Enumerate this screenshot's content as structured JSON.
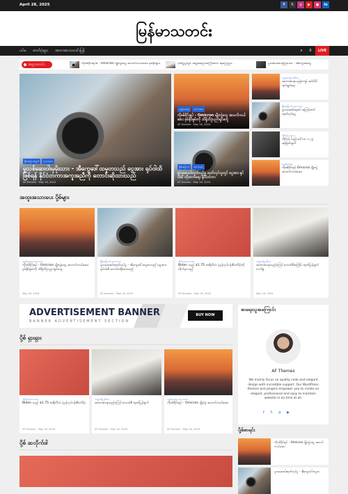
{
  "topbar": {
    "date": "April 28, 2025",
    "social": [
      "f",
      "𝕏",
      "◎",
      "▶",
      "●",
      "in"
    ]
  },
  "brand": {
    "logo": "မြန်မာသတင်း"
  },
  "nav": {
    "items": [
      "ပင်မ",
      "ဓာတ်ပုံများ",
      "အားကစားသတင်းပြန်"
    ],
    "live_label": "LIVE",
    "count": "0"
  },
  "ticker": {
    "label": "အထူးသတင်း",
    "items": [
      "ကိုဗစ်ဗိုင်းရပ်စ် - Omicron မျိုးကွဲတွေ အသက်ကယ်ဆေး ခုခံနိုင်စွမ်း",
      "ဂုဏ်ပြုပွဲတွင် အဖွဲ့အစည်းအကြီးအကဲ ဆုကြေညာ",
      "မှုသစ်မထားခဲ့ကြသော - အီကွေအတွေ"
    ]
  },
  "hero": {
    "main": {
      "cats": [
        "ခြိမ်းခြောက်ချက်",
        "အားကစား"
      ],
      "title": "မှုသစ်ဆေးဝါးမှမိုးသား - အီကွေဒေါ်ထမှုတသည် ငွေအား ရုပ်ဝါထိ ဖြစ်ရန် နိုင်ငံတကာအကူအညီကို တောင်းဆိုထားသည်",
      "author": "AF themes",
      "date": "May 16, 2024"
    },
    "mid1": {
      "cats": [
        "ကျန်းမာရေး",
        "အားကစား"
      ],
      "title": "ကိုဗစ်ဗိုင်းရပ် - Omicron မျိုးကွဲတွေ အသက်ကယ်ဆေး ခုခံနိုင်စွမ်းကို သိရှိသိပ္ပံပညာရှင်တွေ",
      "author": "AF themes",
      "date": "May 16, 2024"
    },
    "mid2": {
      "cats": [
        "ခြိမ်းခြောက်",
        "အားကစား"
      ],
      "title": "မူလဆေးဝါးထုတ်လုပ်မှု ထုတ်လုပ်သူတွင် ငွေအား ရုပ်ဝါထိ တိုးတက်ရေး နိုင်ငံတကာ",
      "author": "AF themes",
      "date": "May 16, 2024"
    }
  },
  "side_list": [
    {
      "cat": "ကျန်းမာရေး ခိုင်မာ",
      "title": "အားကစားနာမည်ကျော် အင်္ဂလိပ် အုပ်ချုပ်ရေး"
    },
    {
      "cat": "ခြိမ်းခြောက် အားကစား",
      "title": "မူလဆေးဝါးထုတ် အကြမ်းဖက် ထုတ်လုပ်ငွေ"
    },
    {
      "cat": "ဘိုင်ဒန် ဘူ့လာ",
      "title": "ဘိုင်ဒန် သည် ဒေါ်လာ ၁.၇၅ ဆုံးဖြတ်ချက်"
    },
    {
      "cat": "ကျန်းမာရေး",
      "title": "ကိုဗစ်ဗိုင်းရပ် Omicron မျိုးကွဲ အသက်ကယ်ဆေး"
    }
  ],
  "sec_popular": {
    "title": "အထူးအသားပေး ပို့စ်များ",
    "items": [
      {
        "cat": "ကျန်းမာရေး အားကစား",
        "title": "ကိုဗစ်ဗိုင်းရပ် - Omicron မျိုးကွဲတွေ အသက်ကယ်ဆေး ခုခံနိုင်စွမ်းကို သိရှိသိပ္ပံပညာရှင်တွေ",
        "date": "May 16, 2024"
      },
      {
        "cat": "ခြိမ်းခြောက် အားကစား",
        "title": "မူလဆေးဝါးထုတ်လုပ်မှု - အီကွေဒေါ်ထမှုတသည် ငွေအား ရုပ်ဝါထိ တောင်းဆိုထားသည်",
        "author": "AF themes",
        "date": "May 16, 2024"
      },
      {
        "cat": "ဘိုင်ဒန် အားကစား",
        "title": "Biden သည် $1.75 ထရီလီယံ ပုံမှန်လုပ်ငန်းစီမံကိန်းကို လိုက်နာသည်",
        "author": "AF themes",
        "date": "May 16, 2024"
      },
      {
        "cat": "ကမ္ဘာကိစ္စ ခိုင်မာ",
        "title": "အားကစားနာမည်ကြော် ကောင်စီအကြိမ် ထုတ်ပြန်ချက် လက်စွဲ",
        "date": "May 16, 2024"
      }
    ]
  },
  "ad": {
    "title": "ADVERTISEMENT BANNER",
    "subtitle": "BANNER ADVERTISEMENT SECTION",
    "button": "BUY NOW"
  },
  "sec_must": {
    "title": "ပို့စ် ရှားရှား",
    "items": [
      {
        "cat": "ဘိုင်ဒန် အားကစား",
        "title": "Biden သည် $1.75 ထရီလီယံ ပုံမှန်လုပ်ငန်းစီမံကိန်း",
        "author": "AF themes",
        "date": "May 16, 2024"
      },
      {
        "cat": "ကမ္ဘာကိစ္စ ခိုင်မာ",
        "title": "အားကစားနာမည်ကြော် ကောင်စီ ထုတ်ပြန်ချက်",
        "author": "AF themes",
        "date": "May 16, 2024"
      },
      {
        "cat": "ကျန်းမာရေး အားကစား",
        "title": "ကိုဗစ်ဗိုင်းရပ် - Omicron မျိုးကွဲ အသက်ကယ်ဆေး",
        "author": "AF themes",
        "date": "May 16, 2024"
      }
    ]
  },
  "author": {
    "heading": "စာရေးသူအကြောင်း",
    "name": "AF Themes",
    "bio": "We mainly focus on quality code and elegant design with incredible support. Our WordPress themes and plugins empower you to create an elegant, professional and easy to maintain website in no time at all.",
    "social": [
      "f",
      "𝕏",
      "◎",
      "▶"
    ]
  },
  "latest": {
    "title": "ပို့စ်စာရင်း",
    "items": [
      {
        "title": "ကိုဗစ်ဗိုင်းရပ် - Omicron မျိုးကွဲတွေ အသက်ကယ်ဆေး"
      },
      {
        "title": "မူလဆေးဝါးထုတ်လုပ်မှု - အီကွေဒေါ်ထမှုတ"
      }
    ]
  },
  "sec3": {
    "title": "ပို့စ် ဆလိုက်ဒါ"
  }
}
